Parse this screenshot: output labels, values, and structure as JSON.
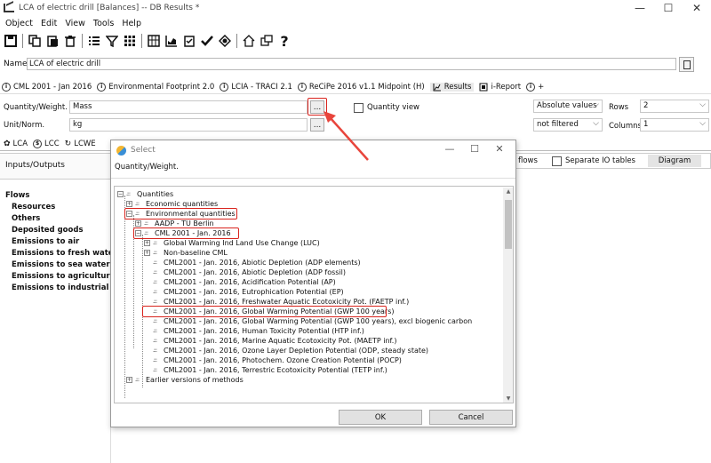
{
  "window": {
    "title": "LCA of electric drill [Balances] -- DB Results *",
    "controls": [
      "—",
      "☐",
      "✕"
    ]
  },
  "menu": [
    "Object",
    "Edit",
    "View",
    "Tools",
    "Help"
  ],
  "toolbar_icons": [
    "save-icon",
    "copy-icon",
    "paste-icon",
    "delete-icon",
    "list-icon",
    "filter-icon",
    "grid-icon",
    "table-icon",
    "chart-icon",
    "checklist-icon",
    "check-icon",
    "target-icon",
    "home-icon",
    "windows-icon",
    "help-icon"
  ],
  "name": {
    "label": "Name",
    "value": "LCA of electric drill"
  },
  "method_tabs": [
    {
      "label": "CML 2001 - Jan 2016",
      "icon": "i"
    },
    {
      "label": "Environmental Footprint 2.0",
      "icon": "i"
    },
    {
      "label": "LCIA - TRACI 2.1",
      "icon": "i"
    },
    {
      "label": "ReCiPe 2016 v1.1 Midpoint (H)",
      "icon": "i"
    },
    {
      "label": "Results",
      "icon": "chart"
    },
    {
      "label": "i-Report",
      "icon": "report"
    },
    {
      "label": "+",
      "icon": "i"
    }
  ],
  "form": {
    "qty_label": "Quantity/Weight.",
    "qty_value": "Mass",
    "unit_label": "Unit/Norm.",
    "unit_value": "kg",
    "dots": "...",
    "quantity_view": "Quantity view",
    "abs_values": "Absolute values",
    "not_filtered": "not filtered",
    "rows_label": "Rows",
    "rows_value": "2",
    "cols_label": "Columns",
    "cols_value": "1"
  },
  "subtabs": [
    "LCA",
    "LCC",
    "LCWE"
  ],
  "io_label": "Inputs/Outputs",
  "flows": {
    "title": "Flows",
    "items": [
      "Resources",
      "Others",
      "Deposited goods",
      "Emissions to air",
      "Emissions to fresh water",
      "Emissions to sea water",
      "Emissions to agricultural s",
      "Emissions to industrial soil"
    ]
  },
  "right_strip": {
    "flows": "flows",
    "separate": "Separate IO tables",
    "diagram": "Diagram"
  },
  "dialog": {
    "title": "Select",
    "controls": [
      "—",
      "☐",
      "✕"
    ],
    "subtitle": "Quantity/Weight.",
    "tree": [
      "Quantities",
      "Economic quantities",
      "Environmental quantities",
      "AADP - TU Berlin",
      "CML 2001 - Jan. 2016",
      "Global Warming Ind Land Use Change (LUC)",
      "Non-baseline CML",
      "CML2001 - Jan. 2016, Abiotic Depletion (ADP elements)",
      "CML2001 - Jan. 2016, Abiotic Depletion (ADP fossil)",
      "CML2001 - Jan. 2016, Acidification Potential (AP)",
      "CML2001 - Jan. 2016, Eutrophication Potential (EP)",
      "CML2001 - Jan. 2016, Freshwater Aquatic Ecotoxicity Pot. (FAETP inf.)",
      "CML2001 - Jan. 2016, Global Warming Potential (GWP 100 years)",
      "CML2001 - Jan. 2016, Global Warming Potential (GWP 100 years), excl biogenic carbon",
      "CML2001 - Jan. 2016, Human Toxicity Potential (HTP inf.)",
      "CML2001 - Jan. 2016, Marine Aquatic Ecotoxicity Pot. (MAETP inf.)",
      "CML2001 - Jan. 2016, Ozone Layer Depletion Potential (ODP, steady state)",
      "CML2001 - Jan. 2016, Photochem. Ozone Creation Potential (POCP)",
      "CML2001 - Jan. 2016, Terrestric Ecotoxicity Potential (TETP inf.)",
      "Earlier versions of methods"
    ],
    "ok": "OK",
    "cancel": "Cancel"
  },
  "colors": {
    "highlight": "#d9231d",
    "arrow": "#e8453c"
  }
}
